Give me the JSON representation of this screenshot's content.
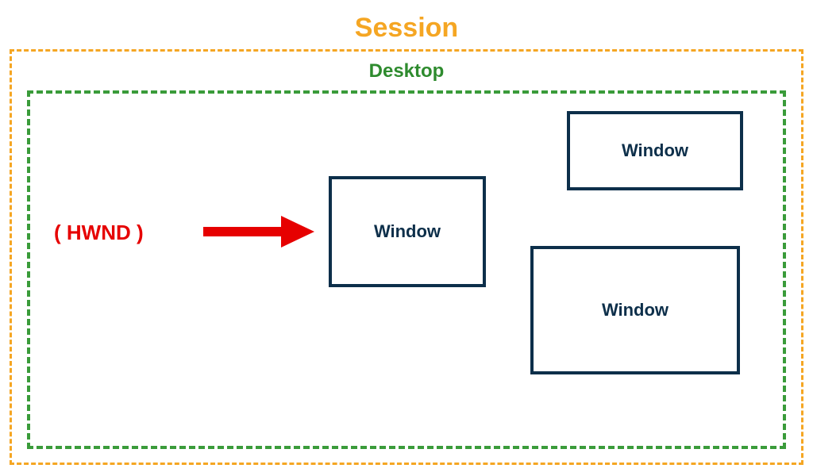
{
  "session": {
    "title": "Session"
  },
  "desktop": {
    "title": "Desktop"
  },
  "hwnd": {
    "label": "( HWND )"
  },
  "windows": {
    "center": {
      "label": "Window"
    },
    "topRight": {
      "label": "Window"
    },
    "bottomRight": {
      "label": "Window"
    }
  },
  "colors": {
    "session": "#f5a623",
    "desktop": "#3a9b3a",
    "windowBorder": "#0d2f4a",
    "arrow": "#e60000"
  }
}
